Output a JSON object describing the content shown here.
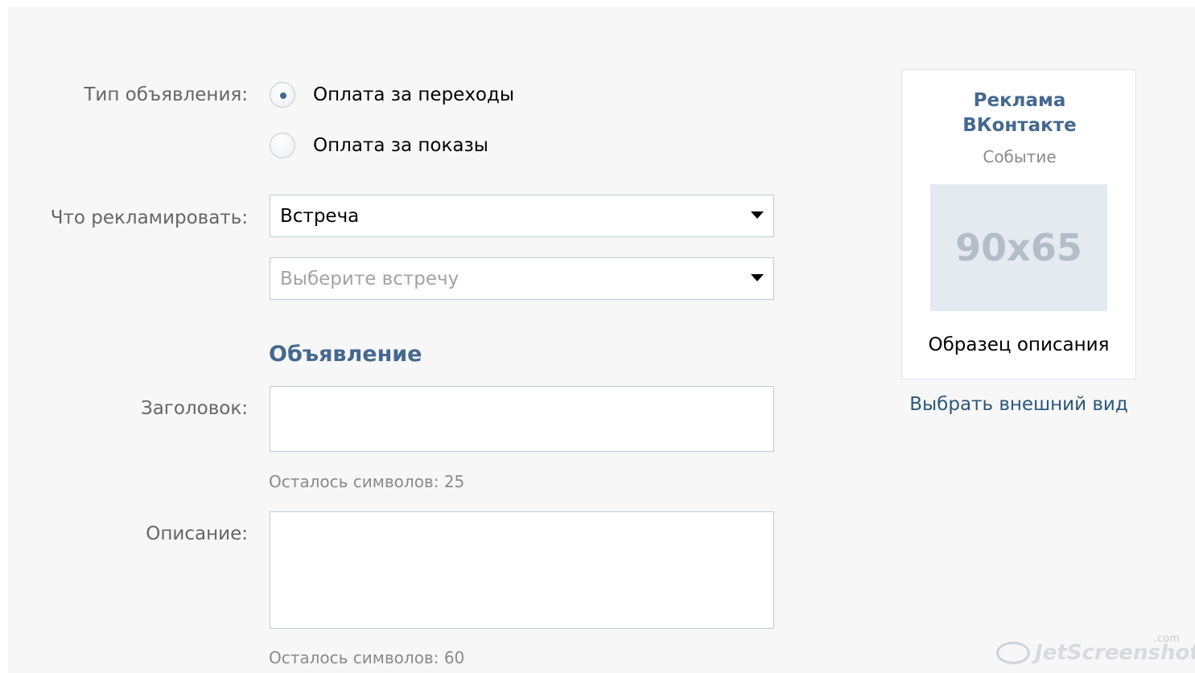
{
  "form": {
    "ad_type_label": "Тип объявления:",
    "ad_type_options": [
      {
        "label": "Оплата за переходы",
        "selected": true
      },
      {
        "label": "Оплата за показы",
        "selected": false
      }
    ],
    "promote_label": "Что рекламировать:",
    "promote_select_value": "Встреча",
    "meeting_select_placeholder": "Выберите встречу",
    "section_title": "Объявление",
    "title_label": "Заголовок:",
    "title_value": "",
    "title_counter": "Осталось символов: 25",
    "description_label": "Описание:",
    "description_value": "",
    "description_counter": "Осталось символов: 60"
  },
  "preview": {
    "title": "Реклама\nВКонтакте",
    "type": "Событие",
    "image_placeholder": "90x65",
    "description": "Образец описания",
    "choose_appearance_link": "Выбрать внешний вид"
  },
  "watermark": {
    "text": "JetScreenshot",
    "suffix": ".com"
  },
  "colors": {
    "background": "#f7f7f7",
    "accent": "#45688e",
    "link": "#2b587a",
    "border": "#c0cad5",
    "muted_text": "#8a8a8a"
  }
}
